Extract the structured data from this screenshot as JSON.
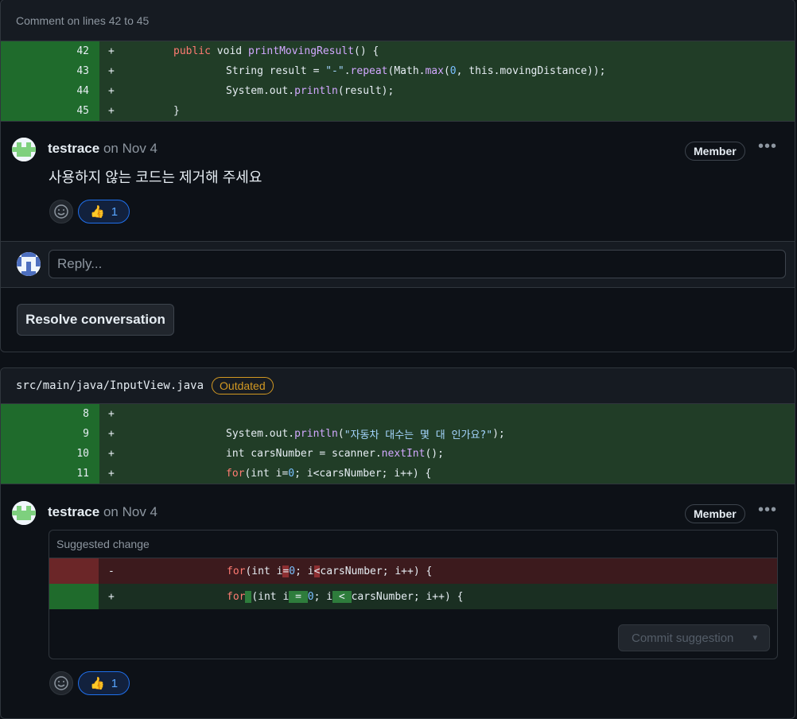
{
  "thread1": {
    "header": "Comment on lines 42 to 45",
    "lines": [
      {
        "num": "42",
        "sign": "+"
      },
      {
        "num": "43",
        "sign": "+"
      },
      {
        "num": "44",
        "sign": "+"
      },
      {
        "num": "45",
        "sign": "+"
      }
    ],
    "code": {
      "l42_kw": "public",
      "l42_a": " void ",
      "l42_fn": "printMovingResult",
      "l42_b": "() {",
      "l43_a": "String result = ",
      "l43_str": "\"-\"",
      "l43_b": ".",
      "l43_fn1": "repeat",
      "l43_c": "(Math.",
      "l43_fn2": "max",
      "l43_d": "(",
      "l43_n": "0",
      "l43_e": ", this.movingDistance));",
      "l44_a": "System.out.",
      "l44_fn": "println",
      "l44_b": "(result);",
      "l45_a": "}"
    },
    "comment": {
      "author": "testrace",
      "date": "on Nov 4",
      "badge": "Member",
      "body": "사용하지 않는 코드는 제거해 주세요",
      "reaction_emoji": "👍",
      "reaction_count": "1"
    },
    "reply_placeholder": "Reply...",
    "resolve_label": "Resolve conversation"
  },
  "thread2": {
    "file": "src/main/java/InputView.java",
    "outdated": "Outdated",
    "lines": [
      {
        "num": "8",
        "sign": "+"
      },
      {
        "num": "9",
        "sign": "+"
      },
      {
        "num": "10",
        "sign": "+"
      },
      {
        "num": "11",
        "sign": "+"
      }
    ],
    "code": {
      "l9_a": "System.out.",
      "l9_fn": "println",
      "l9_b": "(",
      "l9_str": "\"자동차 대수는 몇 대 인가요?\"",
      "l9_c": ");",
      "l10_a": "int carsNumber = scanner.",
      "l10_fn": "nextInt",
      "l10_b": "();",
      "l11_kw": "for",
      "l11_a": "(int i=",
      "l11_n": "0",
      "l11_b": "; i<carsNumber; i++) {"
    },
    "comment": {
      "author": "testrace",
      "date": "on Nov 4",
      "badge": "Member",
      "suggested_header": "Suggested change",
      "del_sign": "-",
      "add_sign": "+",
      "del": {
        "kw": "for",
        "a": "(int i",
        "h1": "=",
        "n": "0",
        "b": "; i",
        "h2": "<",
        "c": "carsNumber; i++) {"
      },
      "add": {
        "kw": "for",
        "h0": " ",
        "a": "(int i",
        "h1": " = ",
        "n": "0",
        "b": "; i",
        "h2": " < ",
        "c": "carsNumber; i++) {"
      },
      "commit_label": "Commit suggestion",
      "reaction_emoji": "👍",
      "reaction_count": "1"
    }
  },
  "colors": {
    "accent": "#1f6feb",
    "added": "#213d27",
    "deleted": "#3c1a1d",
    "outdated": "#d29922"
  }
}
